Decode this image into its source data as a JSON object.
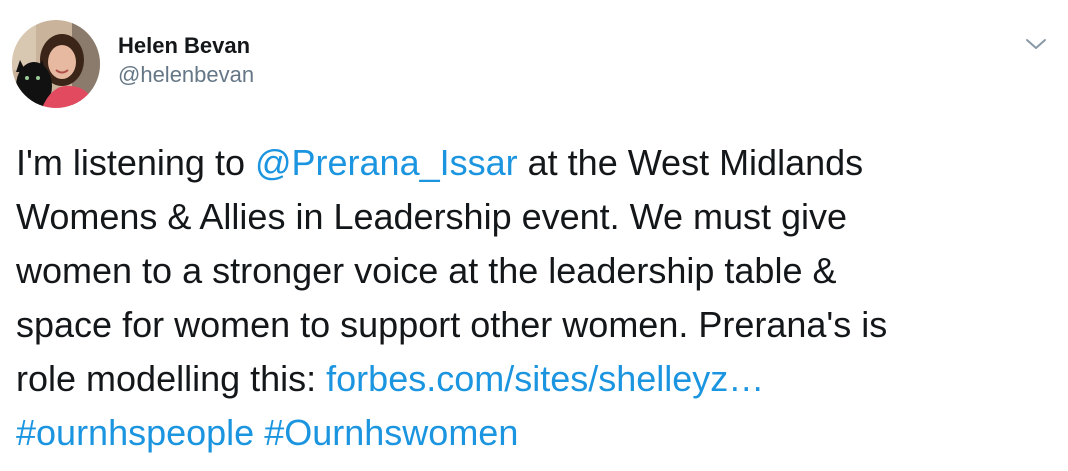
{
  "tweet": {
    "author": {
      "display_name": "Helen Bevan",
      "handle": "@helenbevan"
    },
    "text": {
      "line1_pre": "I'm listening to ",
      "mention": "@Prerana_Issar",
      "line1_post": " at the West Midlands",
      "line2": "Womens & Allies in Leadership event. We must give",
      "line3": "women to a stronger voice at the leadership table &",
      "line4": "space for women to support other women. Prerana's is",
      "line5_pre": "role modelling this: ",
      "url": "forbes.com/sites/shelleyz…",
      "hashtag1": "#ournhspeople",
      "hashtag2": "#Ournhswomen"
    },
    "menu_icon": "chevron-down-icon"
  },
  "colors": {
    "link": "#1b95e0",
    "text": "#14171a",
    "secondary": "#657786"
  }
}
